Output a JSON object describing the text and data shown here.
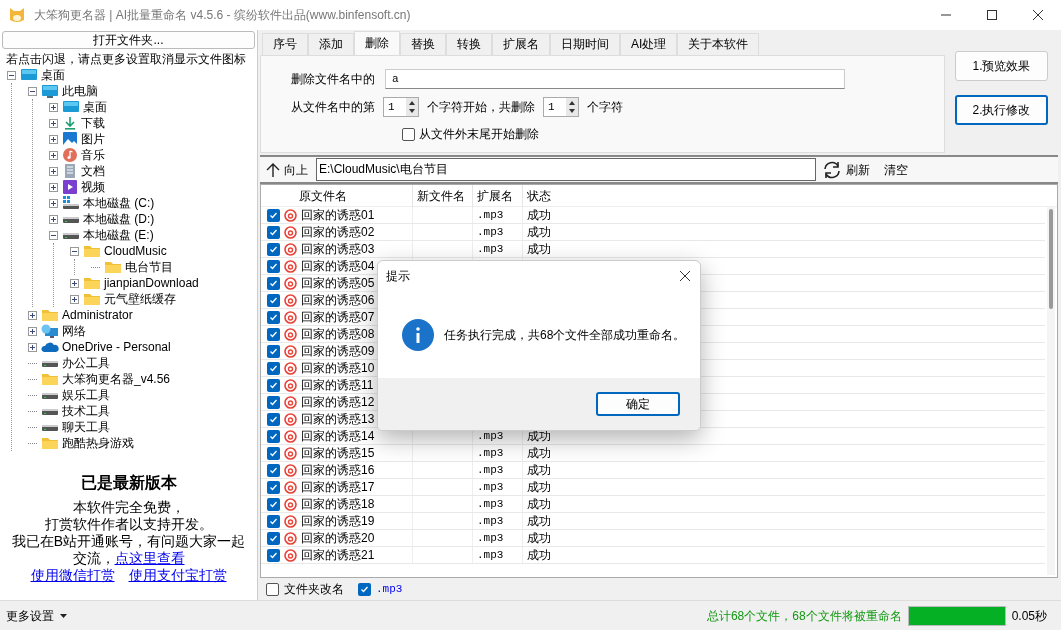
{
  "window": {
    "title": "大笨狗更名器 | AI批量重命名 v4.5.6 - 缤纷软件出品(www.binfensoft.cn)"
  },
  "left_panel": {
    "open_button": "打开文件夹...",
    "hint": "若点击闪退，请点更多设置取消显示文件图标",
    "tree": [
      {
        "label": "桌面",
        "kind": "desktop",
        "has_children": true,
        "expanded": true,
        "children": [
          {
            "label": "此电脑",
            "kind": "pc",
            "has_children": true,
            "expanded": true,
            "children": [
              {
                "label": "桌面",
                "kind": "desktop",
                "has_children": true,
                "expanded": false
              },
              {
                "label": "下载",
                "kind": "download",
                "has_children": true,
                "expanded": false
              },
              {
                "label": "图片",
                "kind": "pictures",
                "has_children": true,
                "expanded": false
              },
              {
                "label": "音乐",
                "kind": "music",
                "has_children": true,
                "expanded": false
              },
              {
                "label": "文档",
                "kind": "docs",
                "has_children": true,
                "expanded": false
              },
              {
                "label": "视频",
                "kind": "video",
                "has_children": true,
                "expanded": false
              },
              {
                "label": "本地磁盘 (C:)",
                "kind": "system_drive",
                "has_children": true,
                "expanded": false
              },
              {
                "label": "本地磁盘 (D:)",
                "kind": "drive",
                "has_children": true,
                "expanded": false
              },
              {
                "label": "本地磁盘 (E:)",
                "kind": "drive",
                "has_children": true,
                "expanded": true,
                "children": [
                  {
                    "label": "CloudMusic",
                    "kind": "folder",
                    "has_children": true,
                    "expanded": true,
                    "children": [
                      {
                        "label": "电台节目",
                        "kind": "folder",
                        "has_children": false
                      }
                    ]
                  },
                  {
                    "label": "jianpianDownload",
                    "kind": "folder",
                    "has_children": true,
                    "expanded": false
                  },
                  {
                    "label": "元气壁纸缓存",
                    "kind": "folder",
                    "has_children": true,
                    "expanded": false
                  }
                ]
              }
            ]
          },
          {
            "label": "Administrator",
            "kind": "folder",
            "has_children": true,
            "expanded": false
          },
          {
            "label": "网络",
            "kind": "network",
            "has_children": true,
            "expanded": false
          },
          {
            "label": "OneDrive - Personal",
            "kind": "cloud",
            "has_children": true,
            "expanded": false
          },
          {
            "label": "办公工具",
            "kind": "drive",
            "has_children": false
          },
          {
            "label": "大笨狗更名器_v4.56",
            "kind": "folder",
            "has_children": false
          },
          {
            "label": "娱乐工具",
            "kind": "drive",
            "has_children": false
          },
          {
            "label": "技术工具",
            "kind": "drive",
            "has_children": false
          },
          {
            "label": "聊天工具",
            "kind": "drive",
            "has_children": false
          },
          {
            "label": "跑酷热身游戏",
            "kind": "folder",
            "has_children": false
          }
        ]
      }
    ],
    "about": {
      "title": "已是最新版本",
      "lines": [
        "本软件完全免费，",
        "打赏软件作者以支持开发。"
      ],
      "contact": "我已在B站开通账号，有问题大家一起交流，",
      "contact_link": "点这里查看",
      "donate_links": [
        "使用微信打赏",
        "使用支付宝打赏"
      ]
    }
  },
  "tabs": [
    {
      "label": "序号",
      "selected": false
    },
    {
      "label": "添加",
      "selected": false
    },
    {
      "label": "删除",
      "selected": true
    },
    {
      "label": "替换",
      "selected": false
    },
    {
      "label": "转换",
      "selected": false
    },
    {
      "label": "扩展名",
      "selected": false
    },
    {
      "label": "日期时间",
      "selected": false
    },
    {
      "label": "AI处理",
      "selected": false
    },
    {
      "label": "关于本软件",
      "selected": false
    }
  ],
  "delete_options": {
    "text_label": "删除文件名中的",
    "text_value": "a",
    "from_label": "从文件名中的第",
    "start_value": "1",
    "middle_label": "个字符开始，共删除",
    "count_value": "1",
    "end_label": "个字符",
    "from_end": {
      "label": "从文件外末尾开始删除",
      "checked": false
    }
  },
  "actions": [
    {
      "label": "1.预览效果",
      "focused": false
    },
    {
      "label": "2.执行修改",
      "focused": true
    }
  ],
  "path_bar": {
    "up_label": "向上",
    "path": "E:\\CloudMusic\\电台节目",
    "refresh_label": "刷新",
    "clear_label": "清空"
  },
  "table": {
    "columns": [
      "原文件名",
      "新文件名",
      "扩展名",
      "状态"
    ],
    "rows": [
      {
        "checked": true,
        "name": "回家的诱惑01",
        "extension": ".mp3",
        "status": "成功"
      },
      {
        "checked": true,
        "name": "回家的诱惑02",
        "extension": ".mp3",
        "status": "成功"
      },
      {
        "checked": true,
        "name": "回家的诱惑03",
        "extension": ".mp3",
        "status": "成功"
      },
      {
        "checked": true,
        "name": "回家的诱惑04"
      },
      {
        "checked": true,
        "name": "回家的诱惑05"
      },
      {
        "checked": true,
        "name": "回家的诱惑06"
      },
      {
        "checked": true,
        "name": "回家的诱惑07"
      },
      {
        "checked": true,
        "name": "回家的诱惑08"
      },
      {
        "checked": true,
        "name": "回家的诱惑09"
      },
      {
        "checked": true,
        "name": "回家的诱惑10"
      },
      {
        "checked": true,
        "name": "回家的诱惑11"
      },
      {
        "checked": true,
        "name": "回家的诱惑12"
      },
      {
        "checked": true,
        "name": "回家的诱惑13"
      },
      {
        "checked": true,
        "name": "回家的诱惑14",
        "extension": ".mp3",
        "status": "成功"
      },
      {
        "checked": true,
        "name": "回家的诱惑15",
        "extension": ".mp3",
        "status": "成功"
      },
      {
        "checked": true,
        "name": "回家的诱惑16",
        "extension": ".mp3",
        "status": "成功"
      },
      {
        "checked": true,
        "name": "回家的诱惑17",
        "extension": ".mp3",
        "status": "成功"
      },
      {
        "checked": true,
        "name": "回家的诱惑18",
        "extension": ".mp3",
        "status": "成功"
      },
      {
        "checked": true,
        "name": "回家的诱惑19",
        "extension": ".mp3",
        "status": "成功"
      },
      {
        "checked": true,
        "name": "回家的诱惑20",
        "extension": ".mp3",
        "status": "成功"
      },
      {
        "checked": true,
        "name": "回家的诱惑21",
        "extension": ".mp3",
        "status": "成功"
      }
    ]
  },
  "options": [
    {
      "label": "文件夹改名",
      "kind": "folder",
      "checked": false
    },
    {
      "label": ".mp3",
      "kind": "extension",
      "checked": true
    }
  ],
  "status_bar": {
    "menu_label": "更多设置",
    "summary": "总计68个文件，68个文件将被重命名",
    "progress": {
      "level": 1
    },
    "time": "0.05秒"
  },
  "dialog": {
    "title": "提示",
    "message": "任务执行完成，共68个文件全部成功重命名。",
    "button": "确定"
  }
}
